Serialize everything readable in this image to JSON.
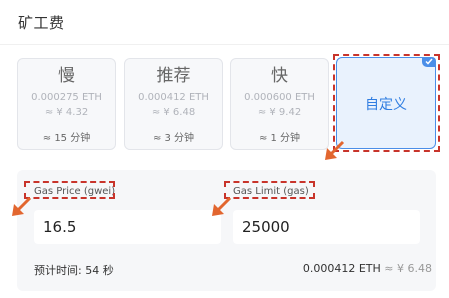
{
  "header": {
    "title": "矿工费"
  },
  "speeds": [
    {
      "name": "慢",
      "eth": "0.000275 ETH",
      "cny": "≈ ¥ 4.32",
      "time": "≈ 15 分钟"
    },
    {
      "name": "推荐",
      "eth": "0.000412 ETH",
      "cny": "≈ ¥ 6.48",
      "time": "≈ 3 分钟"
    },
    {
      "name": "快",
      "eth": "0.000600 ETH",
      "cny": "≈ ¥ 9.42",
      "time": "≈ 1 分钟"
    }
  ],
  "custom": {
    "label": "自定义",
    "selected": true
  },
  "form": {
    "gas_price_label": "Gas Price (gwei)",
    "gas_price_value": "16.5",
    "gas_limit_label": "Gas Limit (gas)",
    "gas_limit_value": "25000"
  },
  "footer": {
    "estimated_time": "预计时间: 54 秒",
    "fee_eth": "0.000412 ETH",
    "fee_cny": "≈ ¥ 6.48"
  },
  "colors": {
    "accent": "#4a8ee8",
    "annotation": "#c8342b",
    "arrow": "#e2662f"
  }
}
